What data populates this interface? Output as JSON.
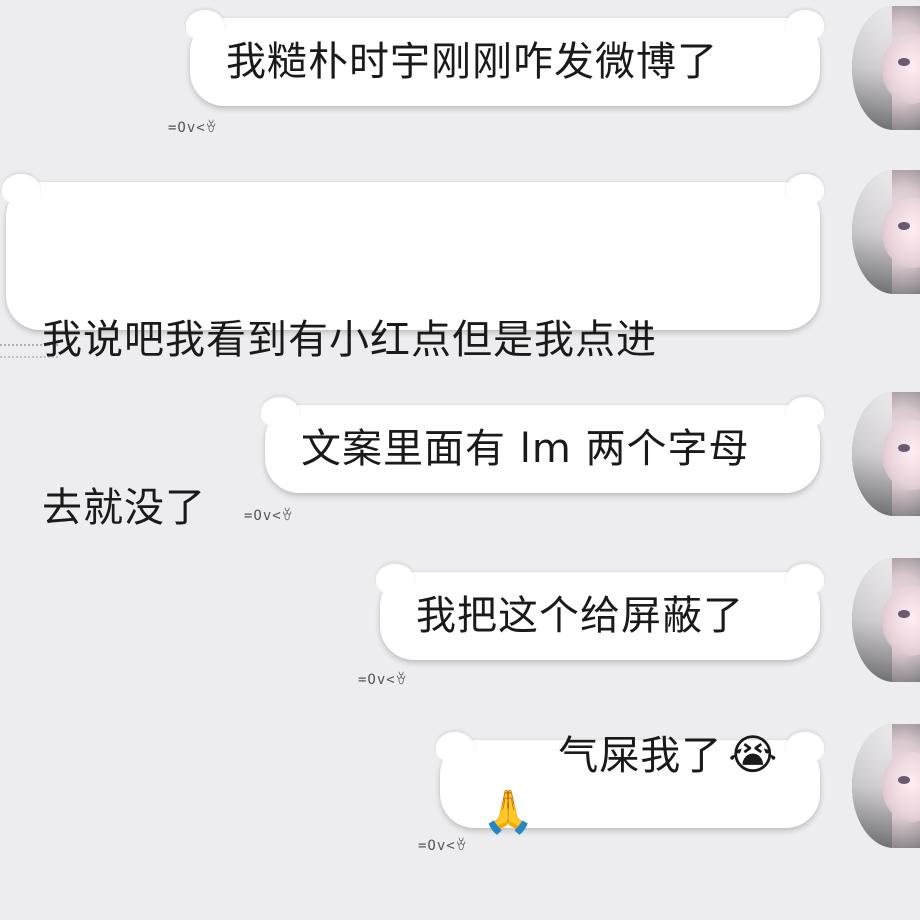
{
  "messages": [
    {
      "text": "我糙朴时宇刚刚咋发微博了",
      "kaomoji": "=Ov<ꈊ"
    },
    {
      "text_line1": "我说吧我看到有小红点但是我点进",
      "text_line2": "去就没了"
    },
    {
      "text": "文案里面有 lm 两个字母",
      "kaomoji": "=Ov<ꈊ"
    },
    {
      "text": "我把这个给屏蔽了",
      "kaomoji": "=Ov<ꈊ"
    },
    {
      "text": "气屎我了",
      "emoji1": "😭",
      "emoji2": "🙏",
      "kaomoji": "=Ov<ꈊ"
    }
  ],
  "colors": {
    "background": "#ededef",
    "bubble": "#ffffff",
    "text": "#1a1a1a"
  },
  "icons": {
    "avatar": "avatar-icon"
  }
}
